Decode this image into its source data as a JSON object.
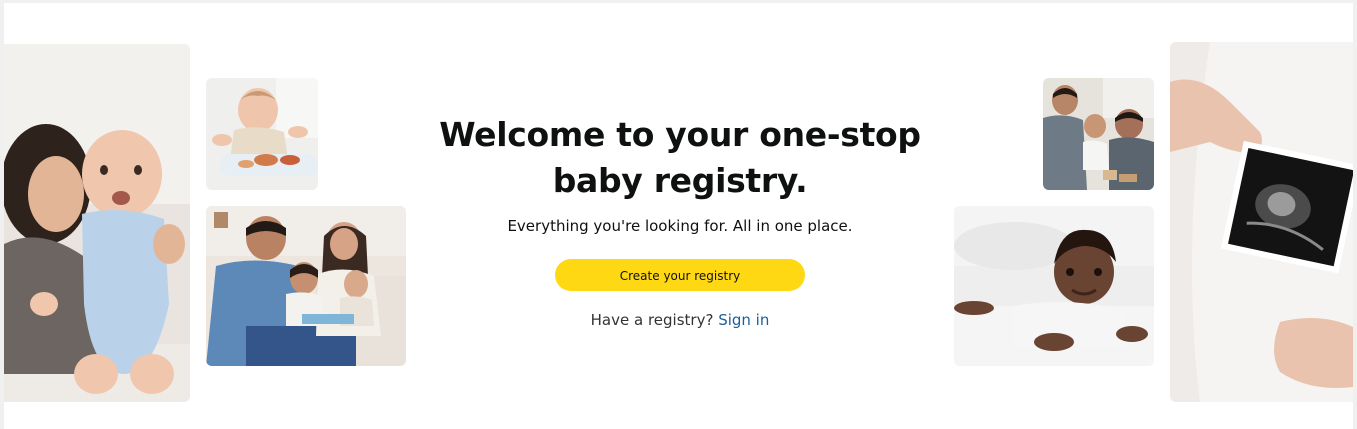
{
  "hero": {
    "title_line1": "Welcome to your one-stop",
    "title_line2": "baby registry.",
    "subtitle": "Everything you're looking for. All in one place.",
    "create_button_label": "Create your registry",
    "have_registry_text": "Have a registry?",
    "sign_in_link": "Sign in"
  },
  "colors": {
    "button_yellow": "#ffd814",
    "link_blue": "#1c5f99",
    "text_dark": "#0f1111"
  }
}
